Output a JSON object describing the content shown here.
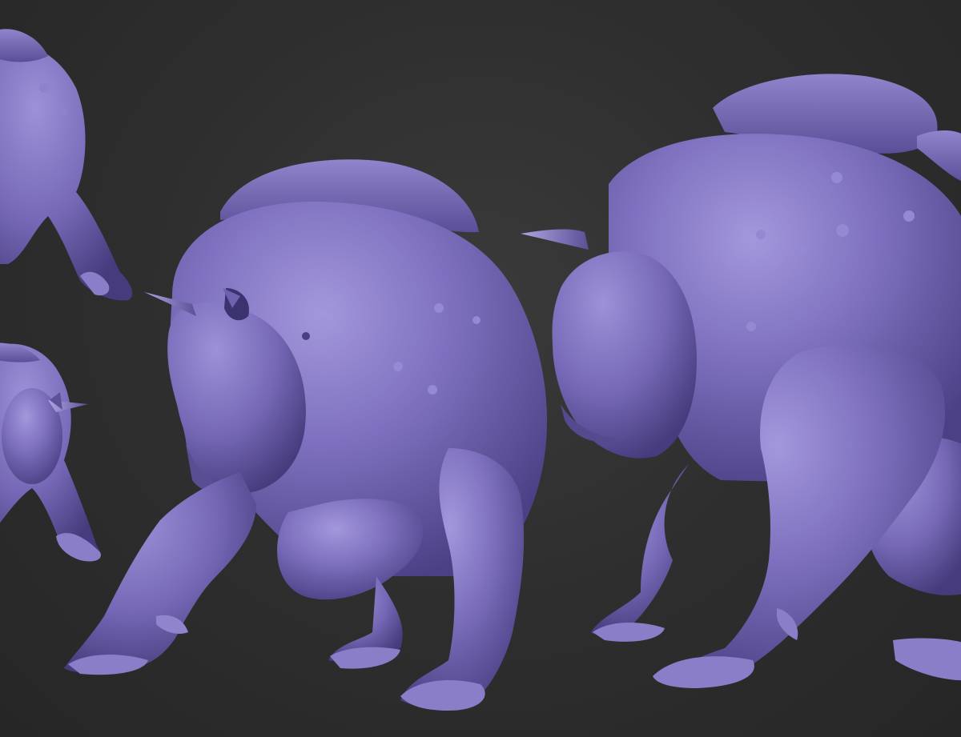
{
  "scene": {
    "background": "#2f2f2f",
    "material_base": "#7a6cb8",
    "material_light": "#9a8fd6",
    "material_shadow": "#4a3f82",
    "horn_color": "#6a5ca6"
  },
  "creatures": [
    {
      "name": "creature-small-top-left"
    },
    {
      "name": "creature-small-bottom-left"
    },
    {
      "name": "creature-center"
    },
    {
      "name": "creature-large-right"
    }
  ]
}
